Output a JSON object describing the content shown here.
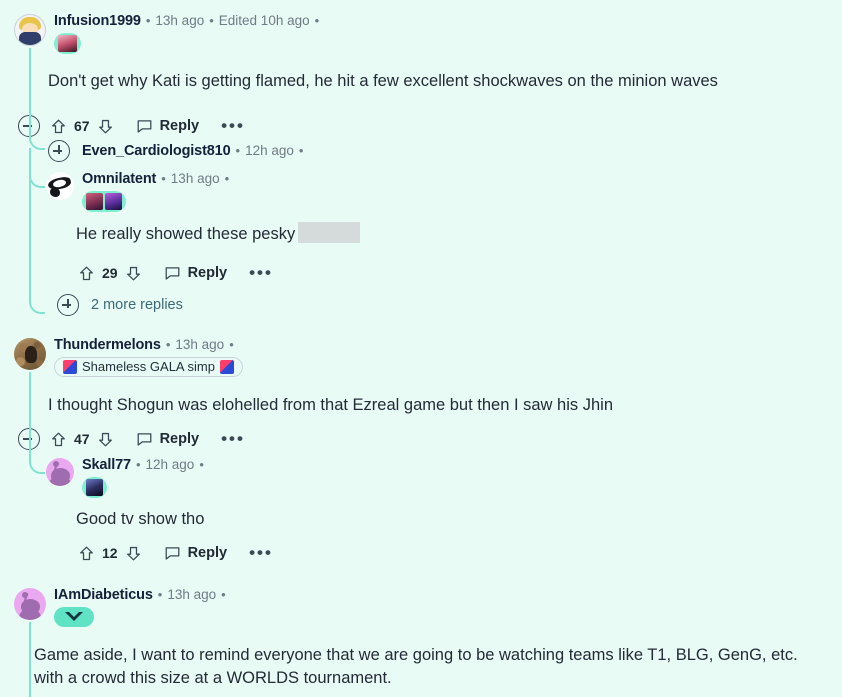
{
  "page": {
    "background_color": "#e9fbf5",
    "thread_line_color": "#7fe3d0",
    "username_color": "#15203a",
    "meta_color": "#6f7b85"
  },
  "comments": [
    {
      "id": "infusion1999",
      "username": "Infusion1999",
      "sep1": "•",
      "timestamp": "13h ago",
      "sep2": "•",
      "edited": "Edited 10h ago",
      "sep3": "•",
      "avatar": "chibi-character-avatar",
      "flair_type": "image",
      "body": "Don't get why Kati is getting flamed, he hit a few excellent shockwaves on the minion waves",
      "score": "67",
      "reply_label": "Reply",
      "more_label": "•••"
    },
    {
      "id": "even_cardiologist810",
      "username": "Even_Cardiologist810",
      "sep1": "•",
      "timestamp": "12h ago",
      "sep2": "•",
      "collapsed": true
    },
    {
      "id": "omnilatent",
      "username": "Omnilatent",
      "sep1": "•",
      "timestamp": "13h ago",
      "sep2": "•",
      "avatar": "lineart-snoo-avatar",
      "flair_type": "image-pair",
      "body_prefix": "He really showed these pesky",
      "body_redacted": true,
      "score": "29",
      "reply_label": "Reply",
      "more_label": "•••"
    },
    {
      "id": "more-replies-1",
      "more_replies_label": "2 more replies"
    },
    {
      "id": "thundermelons",
      "username": "Thundermelons",
      "sep1": "•",
      "timestamp": "13h ago",
      "sep2": "•",
      "avatar": "photo-dog-avatar",
      "flair_type": "text",
      "flair_text": "Shameless GALA simp",
      "body": "I thought Shogun was elohelled from that Ezreal game but then I saw his Jhin",
      "score": "47",
      "reply_label": "Reply",
      "more_label": "•••"
    },
    {
      "id": "skall77",
      "username": "Skall77",
      "sep1": "•",
      "timestamp": "12h ago",
      "sep2": "•",
      "avatar": "snoo-avatar",
      "flair_type": "image",
      "body": "Good tv show tho",
      "score": "12",
      "reply_label": "Reply",
      "more_label": "•••"
    },
    {
      "id": "iamdiabeticus",
      "username": "IAmDiabeticus",
      "sep1": "•",
      "timestamp": "13h ago",
      "sep2": "•",
      "avatar": "snoo-avatar",
      "flair_type": "badge",
      "body": "Game aside, I want to remind everyone that we are going to be watching teams like T1, BLG, GenG, etc. with a crowd this size at a WORLDS tournament."
    }
  ]
}
